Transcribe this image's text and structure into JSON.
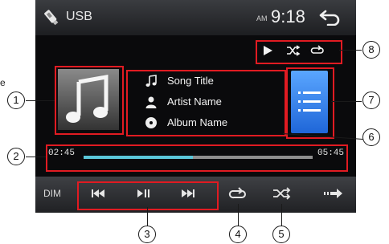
{
  "header": {
    "source_label": "USB",
    "clock_ampm": "AM",
    "clock_time": "9:18",
    "source_icon": "usb-stick-icon",
    "back_icon": "back-arrow-icon"
  },
  "status_icons": [
    "play-status-icon",
    "shuffle-status-icon",
    "repeat-status-icon"
  ],
  "track_info": {
    "title": "Song Title",
    "artist": "Artist Name",
    "album": "Album Name"
  },
  "progress": {
    "current": "02:45",
    "total": "05:45",
    "fraction": 0.478
  },
  "bottom_bar": {
    "dim_label": "DIM"
  },
  "callouts": {
    "n1": "1",
    "n2": "2",
    "n3": "3",
    "n4": "4",
    "n5": "5",
    "n6": "6",
    "n7": "7",
    "n8": "8"
  },
  "edge_fragment": "e",
  "colors": {
    "highlight": "#e11b22",
    "progress_fill": "#5ac6d8",
    "list_button": "#2f7fe8"
  }
}
